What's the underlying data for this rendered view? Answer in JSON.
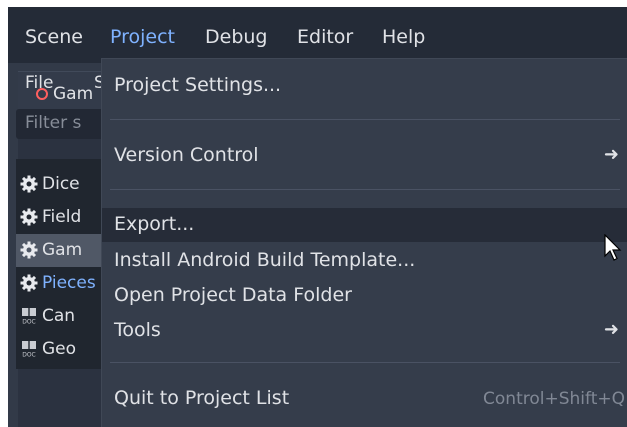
{
  "menubar": {
    "items": [
      {
        "label": "Scene"
      },
      {
        "label": "Project"
      },
      {
        "label": "Debug"
      },
      {
        "label": "Editor"
      },
      {
        "label": "Help"
      }
    ]
  },
  "left_panel": {
    "scene_tab_label": "Gam",
    "file_menu": "File",
    "s_menu": "S",
    "filter_placeholder": "Filter s",
    "list": [
      {
        "label": "Dice",
        "icon": "gear-icon"
      },
      {
        "label": "Field",
        "icon": "gear-icon"
      },
      {
        "label": "Gam",
        "icon": "gear-icon"
      },
      {
        "label": "Pieces",
        "icon": "gear-icon"
      },
      {
        "label": "Can",
        "icon": "doc-icon"
      },
      {
        "label": "Geo",
        "icon": "doc-icon"
      }
    ]
  },
  "project_menu": {
    "items": [
      {
        "label": "Project Settings..."
      },
      {
        "label": "Version Control",
        "arrow": "➜"
      },
      {
        "label": "Export..."
      },
      {
        "label": "Install Android Build Template..."
      },
      {
        "label": "Open Project Data Folder"
      },
      {
        "label": "Tools",
        "arrow": "➜"
      },
      {
        "label": "Quit to Project List",
        "shortcut": "Control+Shift+Q"
      }
    ]
  },
  "colors": {
    "accent": "#7fb2ff",
    "menubar_bg": "#242b37",
    "dropdown_bg": "#353d4b",
    "hover_bg": "#262c38"
  }
}
